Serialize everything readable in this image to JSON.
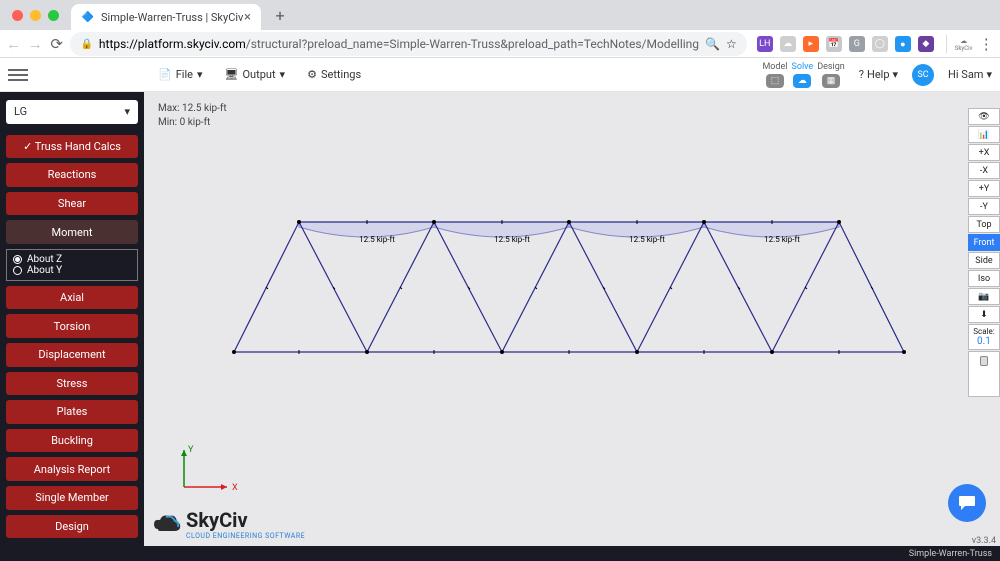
{
  "browser": {
    "tab_title": "Simple-Warren-Truss | SkyCiv",
    "url_secure": "https://platform.skyciv.com",
    "url_path": "/structural?preload_name=Simple-Warren-Truss&preload_path=TechNotes/Modelling"
  },
  "topbar": {
    "file": "File",
    "output": "Output",
    "settings": "Settings",
    "mode_tabs": {
      "model": "Model",
      "solve": "Solve",
      "design": "Design"
    },
    "help": "Help",
    "user_initials": "SC",
    "user_greeting": "Hi Sam"
  },
  "sidebar": {
    "select": "LG",
    "buttons": [
      "✓ Truss Hand Calcs",
      "Reactions",
      "Shear",
      "Moment",
      "Axial",
      "Torsion",
      "Displacement",
      "Stress",
      "Plates",
      "Buckling",
      "Analysis Report",
      "Single Member",
      "Design"
    ],
    "selected_index": 3,
    "radio": {
      "z": "About Z",
      "y": "About Y"
    }
  },
  "canvas": {
    "max_label": "Max: 12.5 kip-ft",
    "min_label": "Min: 0 kip-ft",
    "moment_labels": [
      "12.5 kip-ft",
      "12.5 kip-ft",
      "12.5 kip-ft",
      "12.5 kip-ft"
    ],
    "logo": "SkyCiv",
    "logo_sub": "CLOUD ENGINEERING SOFTWARE",
    "version": "v3.3.4",
    "axis_x": "X",
    "axis_y": "Y"
  },
  "right_toolbar": {
    "buttons": [
      "👁",
      "📊",
      "+X",
      "-X",
      "+Y",
      "-Y",
      "Top",
      "Front",
      "Side",
      "Iso",
      "📷",
      "⬇"
    ],
    "active_index": 7,
    "scale_label": "Scale:",
    "scale_value": "0.1"
  },
  "footer": {
    "project": "Simple-Warren-Truss"
  }
}
